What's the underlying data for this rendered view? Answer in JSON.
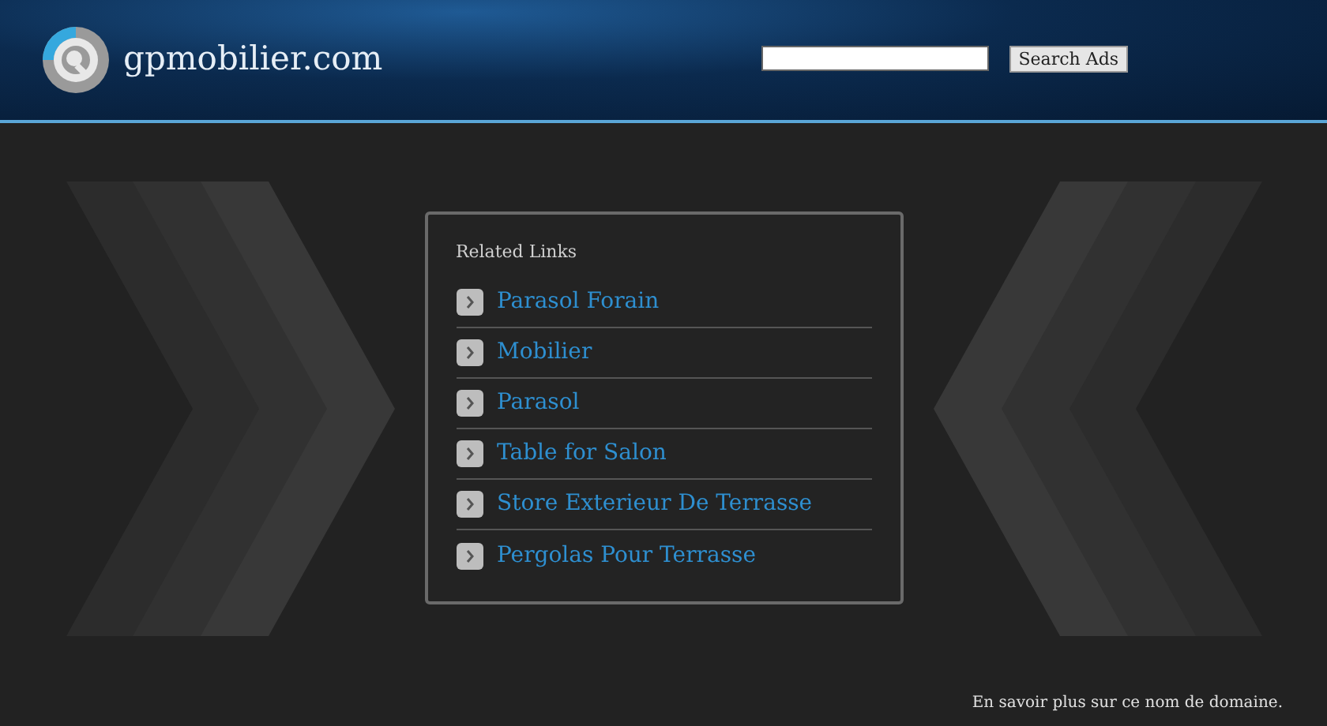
{
  "site": {
    "domain": "gpmobilier.com"
  },
  "search": {
    "button": "Search Ads"
  },
  "related_links": {
    "title": "Related Links",
    "items": [
      "Parasol Forain",
      "Mobilier",
      "Parasol",
      "Table for Salon",
      "Store Exterieur De Terrasse",
      "Pergolas Pour Terrasse"
    ]
  },
  "footer": {
    "link": "En savoir plus sur ce nom de domaine."
  }
}
